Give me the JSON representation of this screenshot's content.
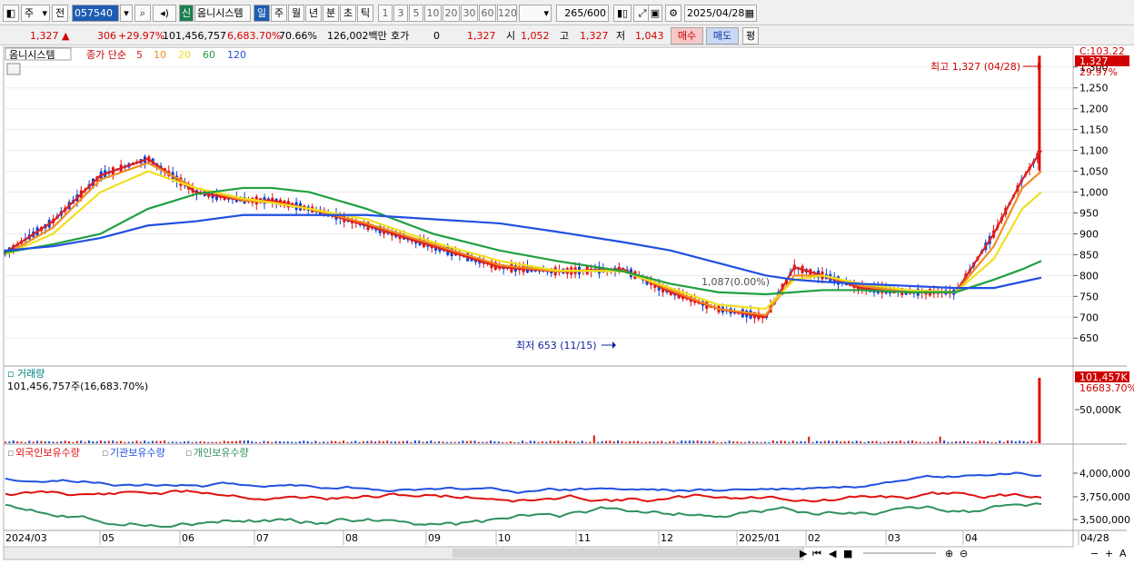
{
  "toolbar": {
    "mode_label": "주",
    "prev_label": "전",
    "code": "057540",
    "sin_label": "신",
    "stock_name": "옴니시스템",
    "periods": [
      "일",
      "주",
      "월",
      "년",
      "분",
      "초",
      "틱"
    ],
    "intervals": [
      "1",
      "3",
      "5",
      "10",
      "20",
      "30",
      "60",
      "120"
    ],
    "count": "265",
    "count_total": "/600",
    "date": "2025/04/28"
  },
  "quote": {
    "price": "1,327",
    "change": "306",
    "change_pct": "+29.97%",
    "volume": "101,456,757",
    "volume_pct": "6,683.70%",
    "turnover_pct": "70.66%",
    "amount": "126,002백만",
    "hoga_label": "호가",
    "hoga_value": "0",
    "hoga_price": "1,327",
    "open_label": "시",
    "open": "1,052",
    "high_label": "고",
    "high": "1,327",
    "low_label": "저",
    "low": "1,043",
    "buy_label": "매수",
    "sell_label": "매도",
    "avg_label": "평"
  },
  "price_panel": {
    "title": "옴니시스템",
    "ma_label": "종가 단순",
    "ma_periods": [
      "5",
      "10",
      "20",
      "60",
      "120"
    ],
    "ma_colors": [
      "#e02020",
      "#f08c20",
      "#f0e020",
      "#20a040",
      "#2050e0"
    ],
    "high_annotation": "최고 1,327 (04/28)",
    "low_annotation": "최저 653 (11/15)",
    "mid_annotation": "1,087(0.00%)",
    "top_axis_label": "C:103.22",
    "last_price_tag": "1,327",
    "last_pct_tag": "29.97%"
  },
  "volume_panel": {
    "title": "거래량",
    "summary": "101,456,757주(16,683.70%)",
    "tick": "50,000K",
    "tag_value": "101,457K",
    "tag_pct": "16683.70%"
  },
  "holdings_panel": {
    "legends": [
      "외국인보유수량",
      "기관보유수량",
      "개인보유수량"
    ],
    "colors": [
      "#e01010",
      "#2050e0",
      "#309060"
    ],
    "ticks": [
      "4,000,000",
      "3,750,000",
      "3,500,000"
    ]
  },
  "x_axis": {
    "labels": [
      "2024/03",
      "05",
      "06",
      "07",
      "08",
      "09",
      "10",
      "11",
      "12",
      "2025/01",
      "02",
      "03",
      "04",
      "04/28"
    ]
  },
  "chart_data": {
    "type": "line",
    "title": "",
    "ylim": [
      620,
      1330
    ],
    "yticks": [
      1300,
      1250,
      1200,
      1150,
      1100,
      1050,
      1000,
      950,
      900,
      850,
      800,
      750,
      700,
      650
    ],
    "series": [
      {
        "name": "5",
        "x": [
          0,
          5,
          10,
          15,
          20,
          25,
          28,
          32,
          38,
          45,
          52,
          58,
          65,
          70,
          75,
          80,
          83,
          86,
          90,
          95,
          100,
          104,
          107,
          109
        ],
        "values": [
          855,
          930,
          1040,
          1080,
          1000,
          980,
          980,
          960,
          920,
          870,
          820,
          810,
          815,
          760,
          720,
          700,
          820,
          800,
          770,
          760,
          760,
          900,
          1030,
          1100
        ]
      },
      {
        "name": "10",
        "x": [
          0,
          5,
          10,
          15,
          20,
          25,
          28,
          32,
          38,
          45,
          52,
          58,
          65,
          70,
          75,
          80,
          83,
          86,
          90,
          95,
          100,
          104,
          107,
          109
        ],
        "values": [
          850,
          915,
          1030,
          1070,
          1010,
          980,
          975,
          960,
          925,
          875,
          825,
          810,
          812,
          765,
          720,
          705,
          800,
          800,
          775,
          760,
          760,
          870,
          1010,
          1050
        ]
      },
      {
        "name": "20",
        "x": [
          0,
          5,
          10,
          15,
          20,
          25,
          28,
          32,
          38,
          45,
          52,
          58,
          65,
          70,
          75,
          80,
          83,
          86,
          90,
          95,
          100,
          104,
          107,
          109
        ],
        "values": [
          850,
          900,
          1000,
          1050,
          1010,
          985,
          975,
          960,
          935,
          880,
          835,
          812,
          810,
          770,
          730,
          720,
          790,
          800,
          780,
          765,
          760,
          840,
          960,
          1000
        ]
      },
      {
        "name": "60",
        "x": [
          0,
          5,
          10,
          15,
          20,
          25,
          28,
          32,
          38,
          45,
          52,
          58,
          65,
          70,
          75,
          80,
          83,
          86,
          90,
          95,
          100,
          104,
          107,
          109
        ],
        "values": [
          855,
          875,
          900,
          960,
          995,
          1010,
          1010,
          1000,
          960,
          900,
          860,
          835,
          810,
          780,
          760,
          755,
          760,
          765,
          765,
          760,
          760,
          790,
          815,
          835
        ]
      },
      {
        "name": "120",
        "x": [
          0,
          5,
          10,
          15,
          20,
          25,
          28,
          32,
          38,
          45,
          52,
          58,
          65,
          70,
          75,
          80,
          83,
          86,
          90,
          95,
          100,
          104,
          107,
          109
        ],
        "values": [
          860,
          870,
          890,
          920,
          930,
          945,
          945,
          945,
          945,
          935,
          925,
          905,
          880,
          860,
          830,
          800,
          790,
          785,
          780,
          775,
          770,
          770,
          785,
          795
        ]
      }
    ],
    "annotations": {
      "high": {
        "value": 1327,
        "date": "04/28"
      },
      "low": {
        "value": 653,
        "date": "11/15"
      }
    }
  }
}
